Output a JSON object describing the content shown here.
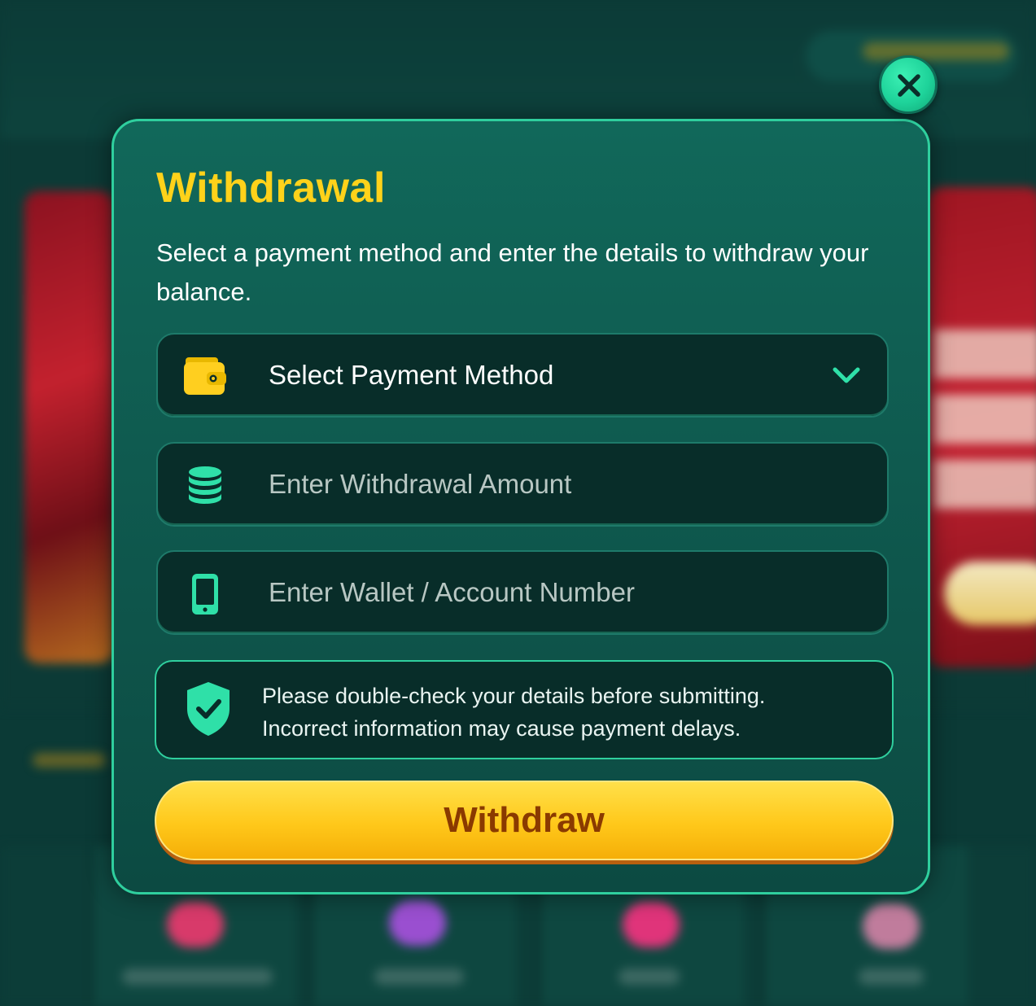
{
  "modal": {
    "title": "Withdrawal",
    "description": "Select a payment method and enter the details to withdraw your balance.",
    "payment_select": {
      "selected_label": "Select Payment Method",
      "icon": "wallet-icon"
    },
    "amount_field": {
      "placeholder": "Enter Withdrawal Amount",
      "icon": "coins-icon"
    },
    "account_field": {
      "placeholder": "Enter Wallet / Account Number",
      "icon": "phone-icon"
    },
    "notice": {
      "icon": "shield-check-icon",
      "line1": "Please double-check your details before submitting.",
      "line2": "Incorrect information may cause payment delays."
    },
    "submit_label": "Withdraw",
    "close_icon": "close-icon"
  },
  "colors": {
    "accent": "#2fcf9e",
    "title": "#ffd21a",
    "button": "#ffc81a",
    "button_text": "#8a3a00",
    "panel": "#0f5a4f",
    "field": "#082d29"
  }
}
